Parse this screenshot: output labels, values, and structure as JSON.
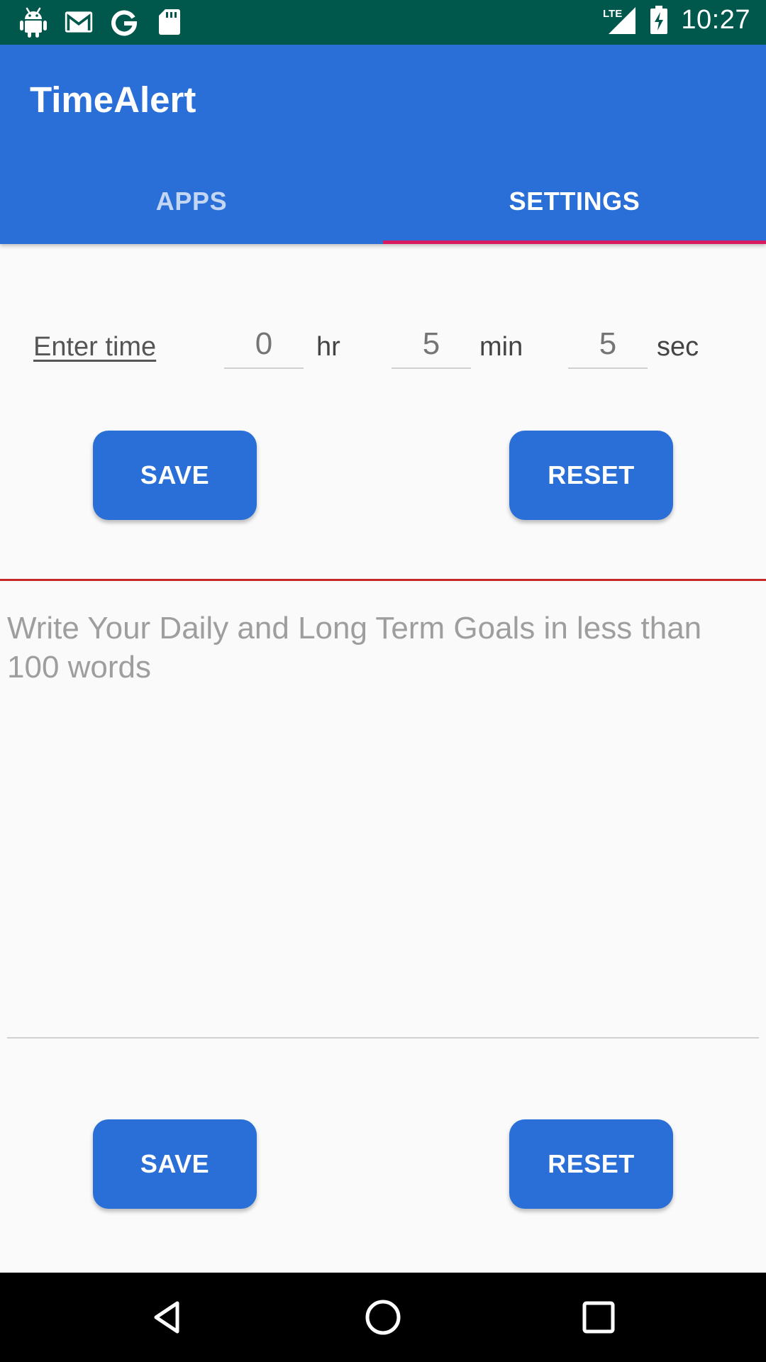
{
  "status_bar": {
    "time": "10:27",
    "network": "LTE",
    "left_icons": [
      "android-icon",
      "gmail-icon",
      "google-icon",
      "sd-card-icon"
    ],
    "right_icons": [
      "lte-signal-icon",
      "battery-charging-icon"
    ]
  },
  "app": {
    "title": "TimeAlert"
  },
  "tabs": [
    {
      "label": "APPS",
      "active": false
    },
    {
      "label": "SETTINGS",
      "active": true
    }
  ],
  "time_entry": {
    "label": "Enter time",
    "hours_placeholder": "0",
    "hours_unit": "hr",
    "minutes_placeholder": "5",
    "minutes_unit": "min",
    "seconds_placeholder": "5",
    "seconds_unit": "sec"
  },
  "top_buttons": {
    "save_label": "SAVE",
    "reset_label": "RESET"
  },
  "goals": {
    "placeholder": "Write Your Daily and Long Term Goals in less than 100 words"
  },
  "bottom_buttons": {
    "save_label": "SAVE",
    "reset_label": "RESET"
  },
  "nav_bar": {
    "icons": [
      "back-icon",
      "home-icon",
      "recents-icon"
    ]
  },
  "colors": {
    "status_bar": "#00574b",
    "primary": "#2a6fd7",
    "tab_indicator": "#d81b60",
    "divider_red": "#c62828"
  }
}
